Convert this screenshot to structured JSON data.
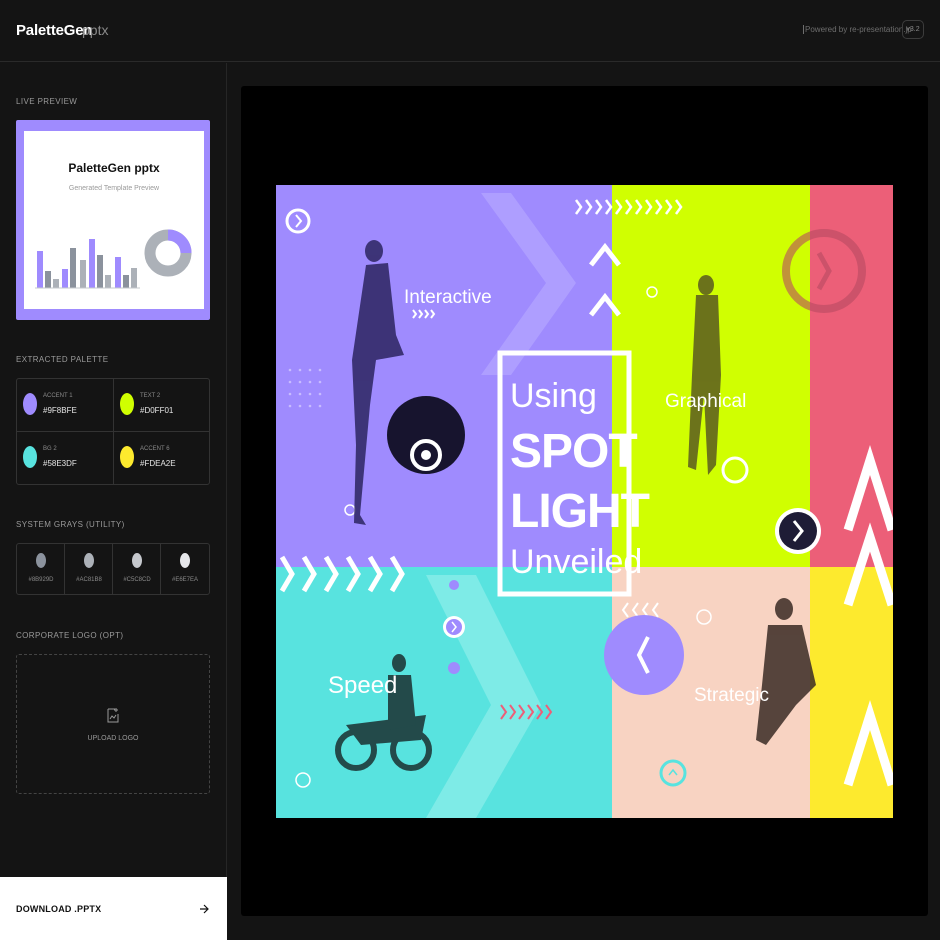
{
  "header": {
    "brand": "PaletteGen",
    "brand_sub": "pptx",
    "powered": "Powered by re-presentation.jp",
    "version": "v3.2"
  },
  "sidebar": {
    "live_preview_title": "LIVE PREVIEW",
    "preview": {
      "title": "PaletteGen pptx",
      "subtitle": "Generated Template Preview"
    },
    "extracted_palette_title": "EXTRACTED PALETTE",
    "palette": [
      {
        "name": "ACCENT 1",
        "hex": "#9F8BFE",
        "color": "#9f8bfe"
      },
      {
        "name": "TEXT 2",
        "hex": "#D0FF01",
        "color": "#d0ff01"
      },
      {
        "name": "BG 2",
        "hex": "#58E3DF",
        "color": "#58e3df"
      },
      {
        "name": "ACCENT 6",
        "hex": "#FDEA2E",
        "color": "#fdea2e"
      }
    ],
    "system_grays_title": "SYSTEM GRAYS (UTILITY)",
    "grays": [
      {
        "hex": "#8B929D",
        "color": "#8b929d"
      },
      {
        "hex": "#AC81B8",
        "color": "#acb1b8"
      },
      {
        "hex": "#C5C8CD",
        "color": "#c5c8cd"
      },
      {
        "hex": "#E6E7EA",
        "color": "#e6e7ea"
      }
    ],
    "corporate_logo_title": "CORPORATE LOGO (OPT)",
    "upload_label": "UPLOAD LOGO",
    "download_label": "DOWNLOAD .PPTX"
  },
  "slide": {
    "title_line1": "Using",
    "title_line2": "SPOT",
    "title_line3": "LIGHT",
    "title_line4": "Unveiled",
    "label_interactive": "Interactive",
    "label_graphical": "Graphical",
    "label_speed": "Speed",
    "label_strategic": "Strategic",
    "colors": {
      "purple": "#9f8bfe",
      "lime": "#d0ff01",
      "pink": "#ec5f78",
      "cyan": "#58e3df",
      "peach": "#f8d3c2",
      "yellow": "#fdea2e"
    }
  }
}
